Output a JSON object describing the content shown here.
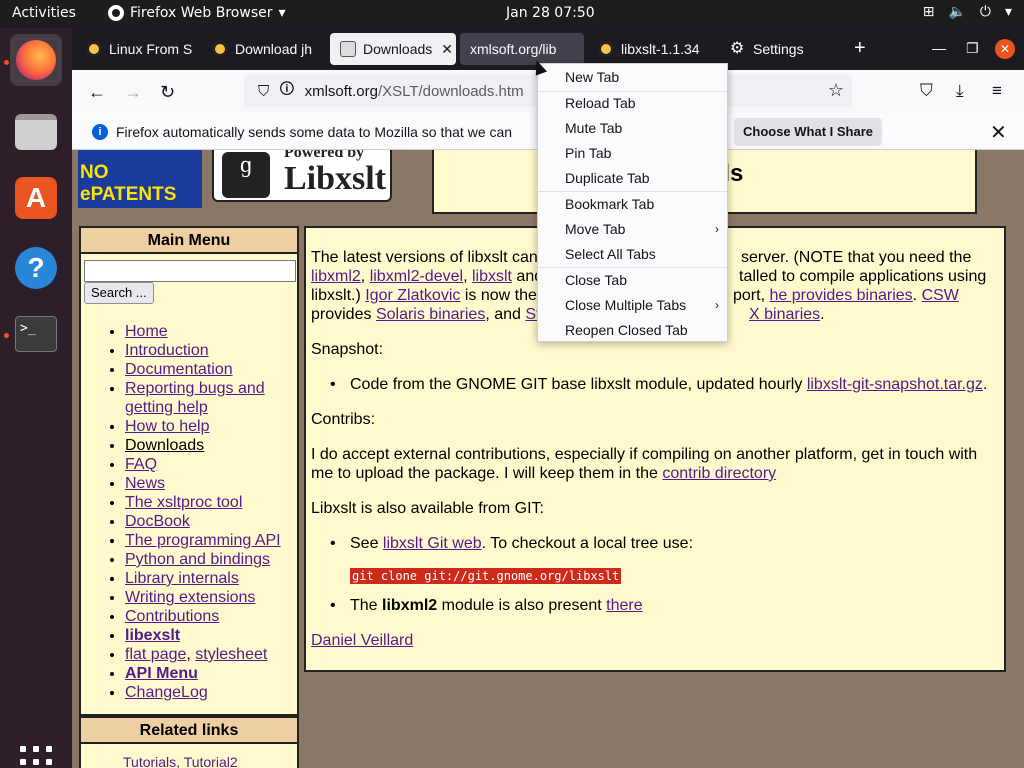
{
  "topbar": {
    "activities": "Activities",
    "app_name": "Firefox Web Browser",
    "clock": "Jan 28  07:50"
  },
  "browser": {
    "tabs": [
      {
        "label": "Linux From S"
      },
      {
        "label": "Download jh"
      },
      {
        "label": "Downloads"
      },
      {
        "label": "xmlsoft.org/lib"
      },
      {
        "label": "libxslt-1.1.34"
      },
      {
        "label": "Settings"
      }
    ],
    "url": {
      "host": "xmlsoft.org",
      "path": "/XSLT/downloads.htm"
    },
    "notification": {
      "text": "Firefox automatically sends some data to Mozilla so that we can",
      "button": "Choose What I Share"
    }
  },
  "context_menu": {
    "items": [
      {
        "label": "New Tab"
      },
      {
        "label": "Reload Tab"
      },
      {
        "label": "Mute Tab"
      },
      {
        "label": "Pin Tab"
      },
      {
        "label": "Duplicate Tab"
      },
      {
        "label": "Bookmark Tab"
      },
      {
        "label": "Move Tab"
      },
      {
        "label": "Select All Tabs"
      },
      {
        "label": "Close Tab"
      },
      {
        "label": "Close Multiple Tabs"
      },
      {
        "label": "Reopen Closed Tab"
      }
    ]
  },
  "page": {
    "logos": {
      "patents": "NO ePATENTS",
      "powered_by": "Powered by",
      "libxslt": "Libxslt"
    },
    "title_visible": "ads",
    "sidebar": {
      "heading": "Main Menu",
      "search_button": "Search ...",
      "items": [
        {
          "label": "Home"
        },
        {
          "label": "Introduction"
        },
        {
          "label": "Documentation"
        },
        {
          "label": "Reporting bugs and getting help"
        },
        {
          "label": "How to help"
        },
        {
          "label": "Downloads"
        },
        {
          "label": "FAQ"
        },
        {
          "label": "News"
        },
        {
          "label": "The xsltproc tool"
        },
        {
          "label": "DocBook"
        },
        {
          "label": "The programming API"
        },
        {
          "label": "Python and bindings"
        },
        {
          "label": "Library internals"
        },
        {
          "label": "Writing extensions"
        },
        {
          "label": "Contributions"
        },
        {
          "label": "libexslt"
        },
        {
          "label": "flat page"
        },
        {
          "label": "stylesheet"
        },
        {
          "label": "API Menu"
        },
        {
          "label": "ChangeLog"
        }
      ],
      "related_heading": "Related links",
      "related_first": "Tutorials, Tutorial2"
    },
    "content": {
      "intro_1": "The latest versions of libxslt can",
      "intro_1b": "server. (NOTE that you need the",
      "libxml2": "libxml2",
      "libxml2_devel": "libxml2-devel",
      "libxslt": "libxslt",
      "intro_2b": "and",
      "intro_2c": "talled to compile applications using",
      "intro_3a": "libxslt.)",
      "igor": "Igor Zlatkovic",
      "intro_3b": "is now the",
      "intro_3c": "port,",
      "he_provides": "he provides binaries",
      "csw": "CSW",
      "intro_4a": "provides",
      "solaris": "Solaris binaries",
      "intro_4b": ", and",
      "st": "St",
      "x_binaries": "X binaries",
      "snapshot": "Snapshot:",
      "snapshot_item": "Code from the GNOME GIT base libxslt module, updated hourly",
      "snapshot_link": "libxslt-git-snapshot.tar.gz",
      "contribs": "Contribs:",
      "contribs_text": "I do accept external contributions, especially if compiling on another platform, get in touch with me to upload the package. I will keep them in the",
      "contrib_dir": "contrib directory",
      "git_avail": "Libxslt is also available from GIT:",
      "see": "See",
      "git_web": "libxslt Git web",
      "checkout": ". To checkout a local tree use:",
      "git_cmd": "git clone git://git.gnome.org/libxslt",
      "the": "The",
      "libxml2_bold": "libxml2",
      "module_present": "module is also present",
      "there": "there",
      "author": "Daniel Veillard"
    }
  }
}
